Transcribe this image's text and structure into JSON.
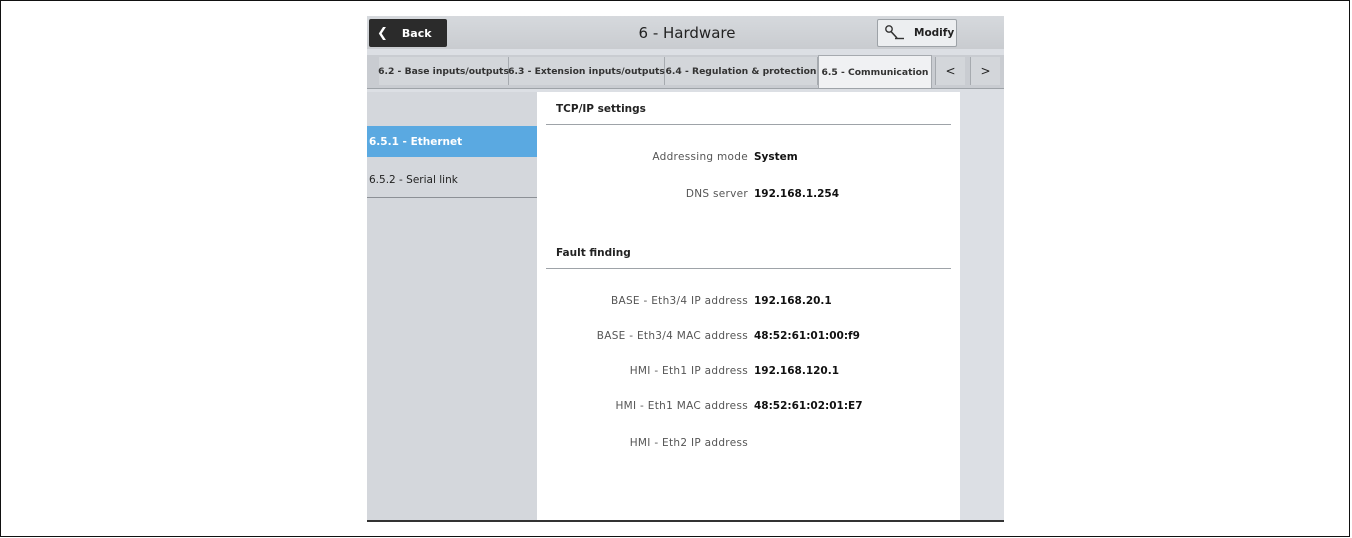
{
  "header": {
    "back_label": "Back",
    "title": "6 - Hardware",
    "modify_label": "Modify"
  },
  "tabs": [
    {
      "label": "6.2 - Base inputs/outputs"
    },
    {
      "label": "6.3 - Extension inputs/outputs"
    },
    {
      "label": "6.4 - Regulation & protection"
    },
    {
      "label": "6.5 - Communication",
      "active": true
    }
  ],
  "tab_nav": {
    "prev": "<",
    "next": ">"
  },
  "sidebar": {
    "items": [
      {
        "label": "6.5.1 - Ethernet",
        "active": true
      },
      {
        "label": "6.5.2 - Serial link"
      }
    ]
  },
  "main": {
    "tcpip": {
      "heading": "TCP/IP settings",
      "rows": [
        {
          "label": "Addressing mode",
          "value": "System"
        },
        {
          "label": "DNS server",
          "value": "192.168.1.254"
        }
      ]
    },
    "fault": {
      "heading": "Fault finding",
      "rows": [
        {
          "label": "BASE - Eth3/4 IP address",
          "value": "192.168.20.1"
        },
        {
          "label": "BASE - Eth3/4 MAC address",
          "value": "48:52:61:01:00:f9"
        },
        {
          "label": "HMI - Eth1 IP address",
          "value": "192.168.120.1"
        },
        {
          "label": "HMI - Eth1 MAC address",
          "value": "48:52:61:02:01:E7"
        },
        {
          "label": "HMI - Eth2 IP address",
          "value": ""
        }
      ]
    }
  },
  "icons": {
    "back": "chevron-left-icon",
    "modify": "wrench-icon"
  },
  "colors": {
    "accent": "#5aa9e1",
    "back_button": "#2b2b2b"
  }
}
